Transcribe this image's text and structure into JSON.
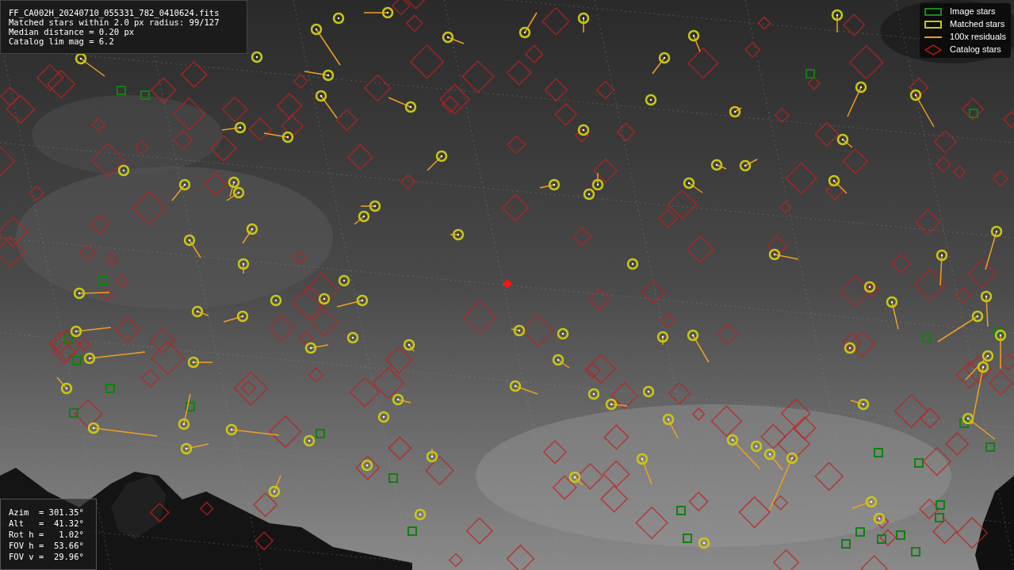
{
  "info": {
    "lines": [
      "FF_CA002H_20240710_055331_782_0410624.fits",
      "Matched stars within 2.0 px radius: 99/127",
      "Median distance = 0.20 px",
      "Catalog lim mag = 6.2"
    ]
  },
  "legend": [
    {
      "label": "Image stars",
      "color": "#1a8a1a"
    },
    {
      "kind": "matched",
      "label": "Matched stars",
      "color": "#c8c814"
    },
    {
      "kind": "residual",
      "label": "100x residuals",
      "color": "#f0a020"
    },
    {
      "kind": "catalog",
      "label": "Catalog stars",
      "color": "#b01818"
    }
  ],
  "pointing": {
    "lines": [
      "Azim  = 301.35°",
      "Alt   =  41.32°",
      "Rot h =   1.02°",
      "FOV h =  53.66°",
      "FOV v =  29.96°"
    ]
  }
}
